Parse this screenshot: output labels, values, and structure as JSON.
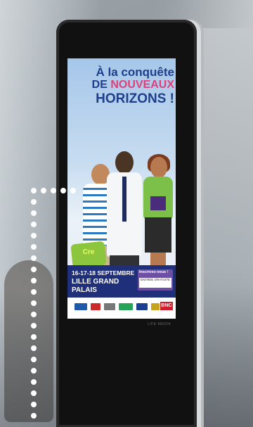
{
  "poster": {
    "title_line1": "À la conquête",
    "title_line2_a": "DE ",
    "title_line2_b": "NOUVEAUX",
    "title_line3": "HORIZONS !",
    "badge_label": "Cre",
    "dates": "16-17-18 SEPTEMBRE",
    "venue": "LILLE GRAND PALAIS",
    "cta_title": "Inscrivez-vous !",
    "cta_sub": "ENTRÉE GRATUITE",
    "sponsor_bnc": "BNC"
  },
  "kiosk": {
    "brand_text": "LIFE·MEDIA"
  },
  "colors": {
    "poster_blue": "#1f3f8c",
    "poster_pink": "#e0407a",
    "band_navy": "#1f2f7a",
    "cta_purple": "#6d4fa5",
    "badge_green": "#8cc63f",
    "bnc_red": "#d11e2e"
  }
}
